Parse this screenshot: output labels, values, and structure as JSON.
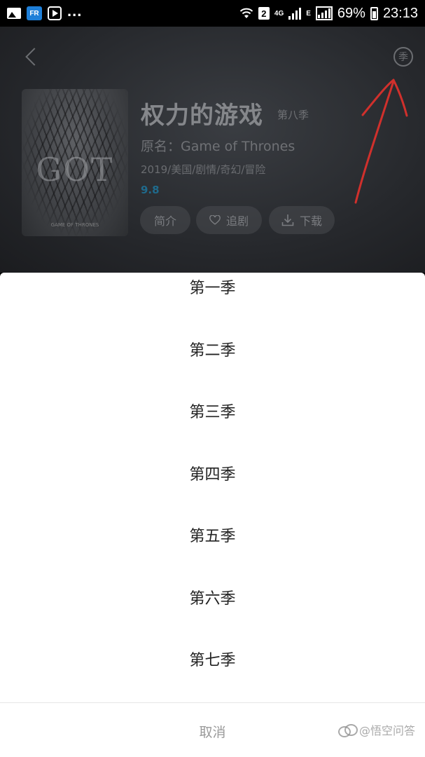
{
  "status_bar": {
    "left_icons": [
      "image-icon",
      "fr-app-icon",
      "video-app-icon"
    ],
    "overflow": "...",
    "sim_slot": "2",
    "network_4g": "4G",
    "network_e": "E",
    "battery": "69%",
    "time": "23:13"
  },
  "header": {
    "title": "权力的游戏",
    "season_tag": "第八季",
    "original_name": "原名：Game of Thrones",
    "meta": "2019/美国/剧情/奇幻/冒险",
    "score": "9.8",
    "season_button": "季",
    "poster_title": "GOT",
    "poster_subtitle": "GAME OF THRONES",
    "actions": {
      "intro": "简介",
      "follow": "追剧",
      "download": "下载"
    }
  },
  "season_sheet": {
    "seasons": [
      "第一季",
      "第二季",
      "第三季",
      "第四季",
      "第五季",
      "第六季",
      "第七季"
    ],
    "cancel": "取消"
  },
  "watermark": "@悟空问答",
  "colors": {
    "sheet_background": "#ffffff",
    "header_background": "#26282c",
    "score": "#1f6a8c",
    "annotation_arrow": "#d0302c"
  }
}
